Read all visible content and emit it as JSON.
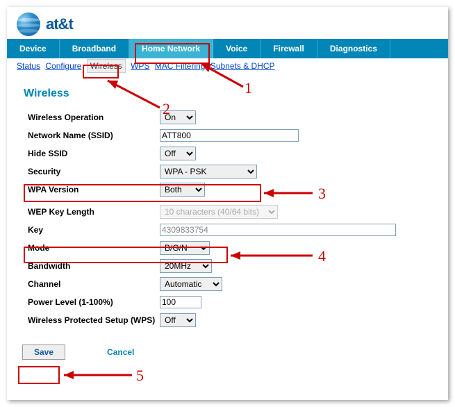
{
  "brand": "at&t",
  "tabs": [
    "Device",
    "Broadband",
    "Home Network",
    "Voice",
    "Firewall",
    "Diagnostics"
  ],
  "activeTabIndex": 2,
  "subnav": {
    "items": [
      "Status",
      "Configure",
      "Wireless",
      "WPS",
      "MAC Filtering",
      "Subnets & DHCP"
    ],
    "currentIndex": 2
  },
  "section_title": "Wireless",
  "form": {
    "wireless_operation": {
      "label": "Wireless Operation",
      "value": "On"
    },
    "ssid": {
      "label": "Network Name (SSID)",
      "value": "ATT800"
    },
    "hide_ssid": {
      "label": "Hide SSID",
      "value": "Off"
    },
    "security": {
      "label": "Security",
      "value": "WPA - PSK"
    },
    "wpa_version": {
      "label": "WPA Version",
      "value": "Both"
    },
    "wep_key_length": {
      "label": "WEP Key Length",
      "value": "10 characters (40/64 bits)"
    },
    "key": {
      "label": "Key",
      "value": "4309833754"
    },
    "mode": {
      "label": "Mode",
      "value": "B/G/N"
    },
    "bandwidth": {
      "label": "Bandwidth",
      "value": "20MHz"
    },
    "channel": {
      "label": "Channel",
      "value": "Automatic"
    },
    "power": {
      "label": "Power Level (1-100%)",
      "value": "100"
    },
    "wps": {
      "label": "Wireless Protected Setup (WPS)",
      "value": "Off"
    }
  },
  "buttons": {
    "save": "Save",
    "cancel": "Cancel"
  },
  "annotations": {
    "n1": "1",
    "n2": "2",
    "n3": "3",
    "n4": "4",
    "n5": "5"
  }
}
